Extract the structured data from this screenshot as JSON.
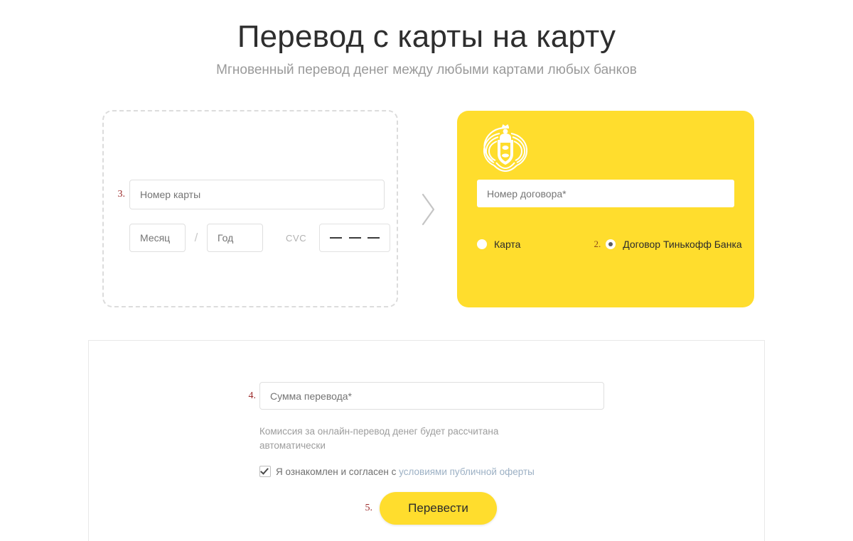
{
  "header": {
    "title": "Перевод с карты на карту",
    "subtitle": "Мгновенный перевод денег между любыми картами любых банков"
  },
  "source_card": {
    "step_marker": "3.",
    "card_number_placeholder": "Номер карты",
    "month_placeholder": "Месяц",
    "separator": "/",
    "year_placeholder": "Год",
    "cvc_label": "CVC",
    "cvc_masked_value": "— — —"
  },
  "arrow": {
    "icon": "chevron-right-icon"
  },
  "dest_card": {
    "logo_icon": "tinkoff-crest-logo",
    "contract_placeholder": "Номер договора",
    "required_star": "*",
    "options": [
      {
        "label": "Карта",
        "selected": false,
        "step_marker": ""
      },
      {
        "label": "Договор Тинькофф Банка",
        "selected": true,
        "step_marker": "2."
      }
    ]
  },
  "bottom_panel": {
    "step_marker": "4.",
    "amount_placeholder": "Сумма перевода",
    "required_star": "*",
    "commission_note": "Комиссия за онлайн-перевод денег будет рассчитана автоматически",
    "agreement_prefix": "Я ознакомлен и согласен с ",
    "agreement_link": "условиями публичной оферты",
    "agreement_checked": true,
    "submit_step_marker": "5.",
    "submit_label": "Перевести"
  },
  "colors": {
    "brand_yellow": "#ffdd2d",
    "title_text": "#2e2e2e",
    "muted_text": "#9a9a9a",
    "step_marker_red": "#9c2b2b",
    "step_marker_brown": "#8d4a18",
    "link_blue": "#9cb0c4"
  }
}
